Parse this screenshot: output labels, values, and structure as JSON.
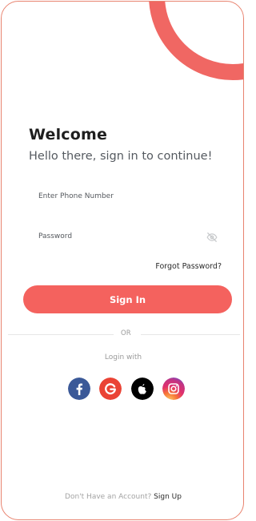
{
  "login": {
    "title": "Welcome",
    "subtitle": "Hello there, sign in to continue!",
    "phone_label": "Enter Phone Number",
    "password_label": "Password",
    "forgot_label": "Forgot Password?",
    "signin_label": "Sign In",
    "or_label": "OR",
    "login_with_label": "Login with",
    "no_account_label": "Don't Have an Account?",
    "signup_label": "Sign Up"
  },
  "social": [
    {
      "icon": "facebook-icon",
      "color": "#3b5998"
    },
    {
      "icon": "google-icon",
      "color": "#ea4335"
    },
    {
      "icon": "apple-icon",
      "color": "#000000"
    },
    {
      "icon": "instagram-icon",
      "color": "#c13584"
    }
  ],
  "icons": {
    "password_toggle": "eye-off-icon"
  },
  "colors": {
    "accent": "#f4625e",
    "border": "#e8836f"
  }
}
